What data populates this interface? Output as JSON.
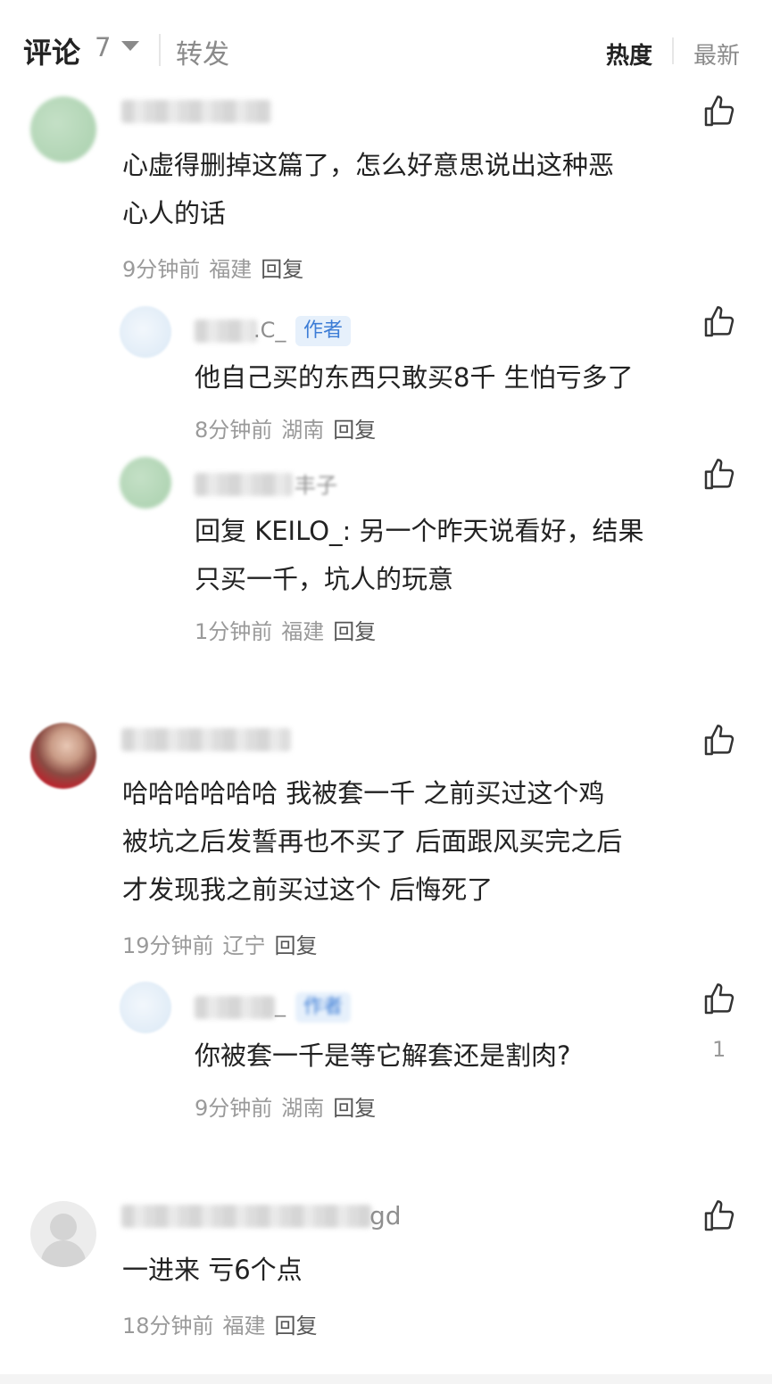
{
  "header": {
    "comments_label": "评论",
    "comments_count": "7",
    "repost_label": "转发",
    "sort_hot": "热度",
    "sort_latest": "最新"
  },
  "comments": [
    {
      "lines": [
        "心虚得删掉这篇了，怎么好意思说出这种恶",
        "心人的话"
      ],
      "time": "9分钟前",
      "location": "福建",
      "reply": "回复",
      "replies": [
        {
          "name_suffix": ".C_",
          "tag": "作者",
          "lines": [
            "他自己买的东西只敢买8千 生怕亏多了"
          ],
          "time": "8分钟前",
          "location": "湖南",
          "reply": "回复"
        },
        {
          "name_suffix": "丰子",
          "lines": [
            "回复 KEILO_: 另一个昨天说看好，结果",
            "只买一千，坑人的玩意"
          ],
          "time": "1分钟前",
          "location": "福建",
          "reply": "回复"
        }
      ]
    },
    {
      "lines": [
        "哈哈哈哈哈哈 我被套一千 之前买过这个鸡",
        "被坑之后发誓再也不买了 后面跟风买完之后",
        "才发现我之前买过这个 后悔死了"
      ],
      "time": "19分钟前",
      "location": "辽宁",
      "reply": "回复",
      "replies": [
        {
          "name_suffix": "_",
          "tag": "作者",
          "lines": [
            "你被套一千是等它解套还是割肉?"
          ],
          "time": "9分钟前",
          "location": "湖南",
          "reply": "回复",
          "likes": "1"
        }
      ]
    },
    {
      "name_suffix": "gd",
      "lines": [
        "一进来 亏6个点"
      ],
      "time": "18分钟前",
      "location": "福建",
      "reply": "回复",
      "replies": []
    }
  ],
  "icons": {
    "like": "thumbs-up-icon",
    "caret": "caret-down-icon"
  },
  "colors": {
    "tag_bg": "#e6f0fb",
    "tag_text": "#3d7dd6",
    "muted": "#9a9a9a"
  }
}
